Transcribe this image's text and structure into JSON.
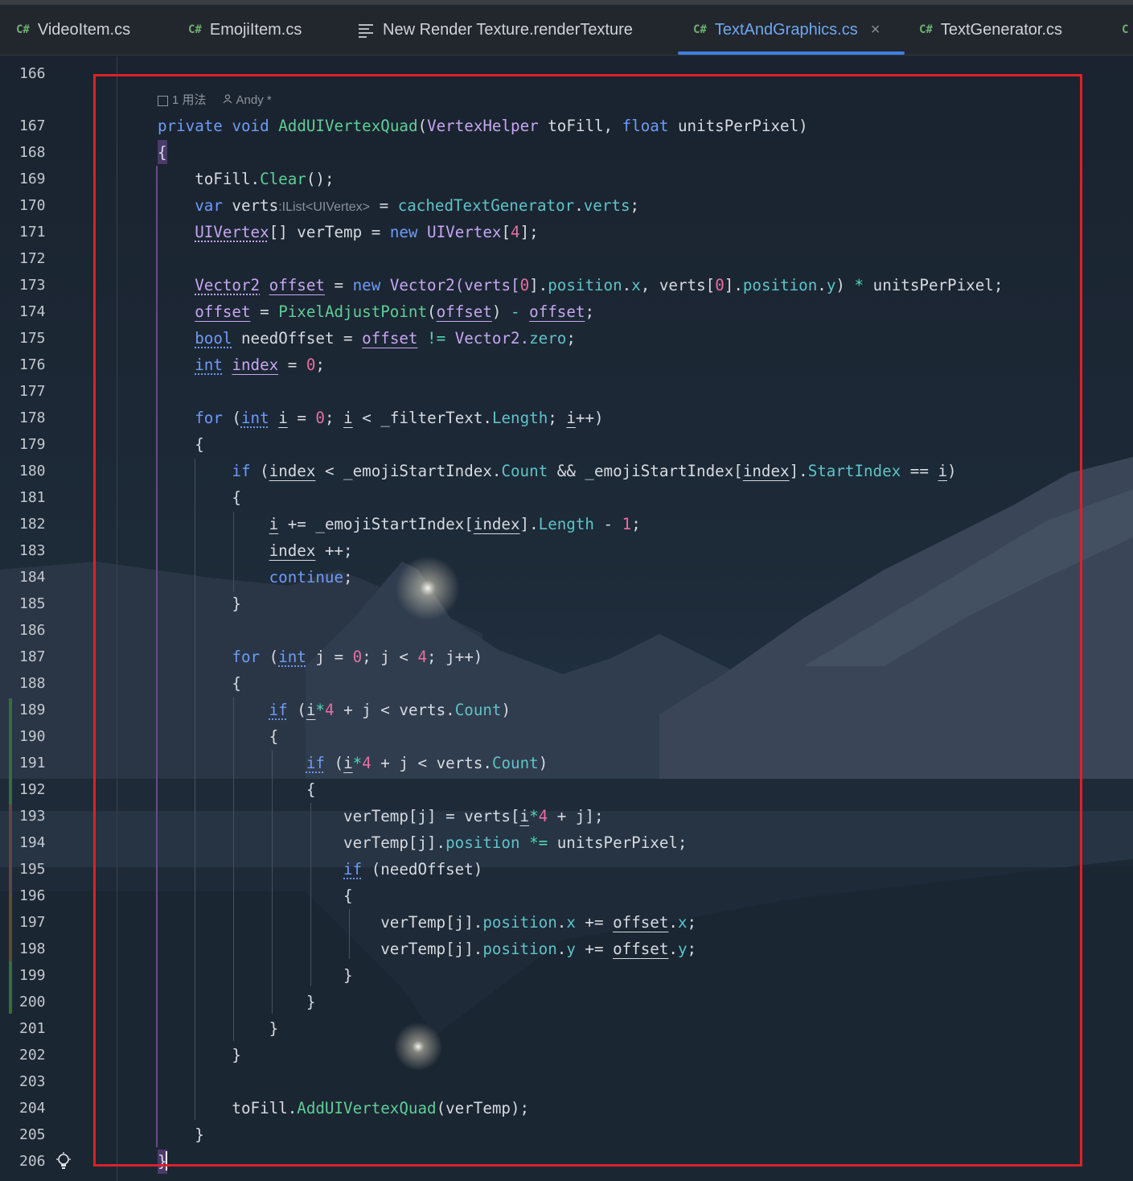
{
  "tabs": [
    {
      "icon": "C#",
      "label": "VideoItem.cs",
      "active": false
    },
    {
      "icon": "C#",
      "label": "EmojiItem.cs",
      "active": false
    },
    {
      "icon": "text",
      "label": "New Render Texture.renderTexture",
      "active": false
    },
    {
      "icon": "C#",
      "label": "TextAndGraphics.cs",
      "active": true,
      "close": "×"
    },
    {
      "icon": "C#",
      "label": "TextGenerator.cs",
      "active": false
    }
  ],
  "overflow_tab_icon": "C",
  "line_numbers": [
    "166",
    "167",
    "168",
    "169",
    "170",
    "171",
    "172",
    "173",
    "174",
    "175",
    "176",
    "177",
    "178",
    "179",
    "180",
    "181",
    "182",
    "183",
    "184",
    "185",
    "186",
    "187",
    "188",
    "189",
    "190",
    "191",
    "192",
    "193",
    "194",
    "195",
    "196",
    "197",
    "198",
    "199",
    "200",
    "201",
    "202",
    "203",
    "204",
    "205",
    "206"
  ],
  "code_meta": {
    "usages": "1 用法",
    "author": "Andy *"
  },
  "code": {
    "l167": {
      "a": "private",
      "b": " ",
      "c": "void",
      "d": " ",
      "e": "AddUIVertexQuad",
      "f": "(",
      "g": "VertexHelper",
      "h": " toFill, ",
      "i": "float",
      "j": " unitsPerPixel)"
    },
    "l168": "{",
    "l169": {
      "a": "    toFill.",
      "b": "Clear",
      "c": "();"
    },
    "l170": {
      "a": "    ",
      "b": "var",
      "c": " verts",
      "d": ":IList<UIVertex>",
      "e": " = ",
      "f": "cachedTextGenerator",
      "g": ".",
      "h": "verts",
      "i": ";"
    },
    "l171": {
      "a": "    ",
      "b": "UIVertex",
      "c": "[] verTemp = ",
      "d": "new",
      "e": " ",
      "f": "UIVertex",
      "g": "[",
      "h": "4",
      "i": "];"
    },
    "l173": {
      "a": "    ",
      "b": "Vector2",
      "c": " ",
      "d": "offset",
      "e": " = ",
      "f": "new",
      "g": " Vector2(verts[",
      "h": "0",
      "i": "].",
      "j": "position",
      "k": ".",
      "l": "x",
      "m": ", verts[",
      "n": "0",
      "o": "].",
      "p": "position",
      "q": ".",
      "r": "y",
      "s": ") ",
      "t": "*",
      "u": " unitsPerPixel;"
    },
    "l174": {
      "a": "    ",
      "b": "offset",
      "c": " = ",
      "d": "PixelAdjustPoint",
      "e": "(",
      "f": "offset",
      "g": ") ",
      "h": "-",
      "i": " ",
      "j": "offset",
      "k": ";"
    },
    "l175": {
      "a": "    ",
      "b": "bool",
      "c": " needOffset = ",
      "d": "offset",
      "e": " ",
      "f": "!=",
      "g": " Vector2.",
      "h": "zero",
      "i": ";"
    },
    "l176": {
      "a": "    ",
      "b": "int",
      "c": " ",
      "d": "index",
      "e": " = ",
      "f": "0",
      "g": ";"
    },
    "l178": {
      "a": "    ",
      "b": "for",
      "c": " (",
      "d": "int",
      "e": " ",
      "f": "i",
      "g": " = ",
      "h": "0",
      "i": "; ",
      "j": "i",
      "k": " < _filterText.",
      "l": "Length",
      "m": "; ",
      "n": "i",
      "o": "++)"
    },
    "l179": "    {",
    "l180": {
      "a": "        ",
      "b": "if",
      "c": " (",
      "d": "index",
      "e": " < _emojiStartIndex.",
      "f": "Count",
      "g": " && _emojiStartIndex[",
      "h": "index",
      "i": "].",
      "j": "StartIndex",
      "k": " == ",
      "l": "i",
      "m": ")"
    },
    "l181": "        {",
    "l182": {
      "a": "            ",
      "b": "i",
      "c": " += _emojiStartIndex[",
      "d": "index",
      "e": "].",
      "f": "Length",
      "g": " - ",
      "h": "1",
      "i": ";"
    },
    "l183": {
      "a": "            ",
      "b": "index",
      "c": " ++;"
    },
    "l184": {
      "a": "            ",
      "b": "continue",
      "c": ";"
    },
    "l185": "        }",
    "l187": {
      "a": "        ",
      "b": "for",
      "c": " (",
      "d": "int",
      "e": " j = ",
      "f": "0",
      "g": "; j < ",
      "h": "4",
      "i": "; j++)"
    },
    "l188": "        {",
    "l189": {
      "a": "            ",
      "b": "if",
      "c": " (",
      "d": "i",
      "e": "*",
      "f": "4",
      "g": " + j < verts.",
      "h": "Count",
      "i": ")"
    },
    "l190": "            {",
    "l191": {
      "a": "                ",
      "b": "if",
      "c": " (",
      "d": "i",
      "e": "*",
      "f": "4",
      "g": " + j < verts.",
      "h": "Count",
      "i": ")"
    },
    "l192": "                {",
    "l193": {
      "a": "                    verTemp[j] = verts[",
      "b": "i",
      "c": "*",
      "d": "4",
      "e": " + j];"
    },
    "l194": {
      "a": "                    verTemp[j].",
      "b": "position",
      "c": " ",
      "d": "*=",
      "e": " unitsPerPixel;"
    },
    "l195": {
      "a": "                    ",
      "b": "if",
      "c": " (needOffset)"
    },
    "l196": "                    {",
    "l197": {
      "a": "                        verTemp[j].",
      "b": "position",
      "c": ".",
      "d": "x",
      "e": " += ",
      "f": "offset",
      "g": ".",
      "h": "x",
      "i": ";"
    },
    "l198": {
      "a": "                        verTemp[j].",
      "b": "position",
      "c": ".",
      "d": "y",
      "e": " += ",
      "f": "offset",
      "g": ".",
      "h": "y",
      "i": ";"
    },
    "l199": "                    }",
    "l200": "                }",
    "l201": "            }",
    "l202": "        }",
    "l204": {
      "a": "        toFill.",
      "b": "AddUIVertexQuad",
      "c": "(verTemp);"
    },
    "l205": "    }",
    "l206": "}"
  },
  "colors": {
    "accent": "#3d7fe0",
    "highlight_border": "#d9222a",
    "keyword": "#6f9bf5",
    "method": "#5fcf95",
    "number": "#e56fa0"
  },
  "icons": {
    "usages": "usages-icon",
    "author": "person-icon",
    "bulb": "lightbulb-icon"
  }
}
